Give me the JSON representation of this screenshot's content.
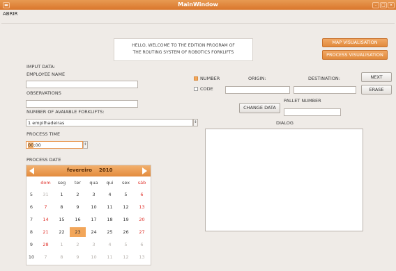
{
  "window": {
    "title": "MainWindow"
  },
  "menu": {
    "abrir": "ABRIR"
  },
  "welcome": {
    "line1": "HELLO, WELCOME TO THE EDITION PROGRAM OF",
    "line2": "THE ROUTING SYSTEM OF ROBOTICS FORKLIFTS"
  },
  "buttons": {
    "map": "MAP VISUALISATION",
    "process": "PROCESS VISUALISATION",
    "next": "NEXT",
    "erase": "ERASE",
    "change_data": "CHANGE DATA"
  },
  "labels": {
    "imput_data": "IMPUT DATA:",
    "employee_name": "EMPLOYEE NAME",
    "observations": "OBSERVATIONS",
    "num_forklifts": "NUMBER OF AVAIABLE FORKLIFTS:",
    "process_time": "PROCESS TIME",
    "process_date": "PROCESS DATE",
    "number": "NUMBER",
    "code": "CODE",
    "origin": "ORIGIN:",
    "destination": "DESTINATION:",
    "pallet_number": "PALLET NUMBER",
    "dialog": "DIALOG"
  },
  "fields": {
    "employee_name": "",
    "observations": "",
    "forklifts": "1 empilhadeiras",
    "time_hour": "00",
    "time_rest": ":00",
    "origin": "",
    "destination": "",
    "pallet_number": ""
  },
  "calendar": {
    "month": "fevereiro",
    "year": "2010",
    "weekdays": [
      "dom",
      "seg",
      "ter",
      "qua",
      "qui",
      "sex",
      "sáb"
    ],
    "weeks": [
      {
        "n": "5",
        "days": [
          "31",
          "1",
          "2",
          "3",
          "4",
          "5",
          "6"
        ]
      },
      {
        "n": "6",
        "days": [
          "7",
          "8",
          "9",
          "10",
          "11",
          "12",
          "13"
        ]
      },
      {
        "n": "7",
        "days": [
          "14",
          "15",
          "16",
          "17",
          "18",
          "19",
          "20"
        ]
      },
      {
        "n": "8",
        "days": [
          "21",
          "22",
          "23",
          "24",
          "25",
          "26",
          "27"
        ]
      },
      {
        "n": "9",
        "days": [
          "28",
          "1",
          "2",
          "3",
          "4",
          "5",
          "6"
        ]
      },
      {
        "n": "10",
        "days": [
          "7",
          "8",
          "9",
          "10",
          "11",
          "12",
          "13"
        ]
      }
    ],
    "selected_day": "23",
    "colors": {
      "weekend": "#e0312a",
      "other_month": "#b7b2ad",
      "selected": "#f2a65a"
    }
  }
}
